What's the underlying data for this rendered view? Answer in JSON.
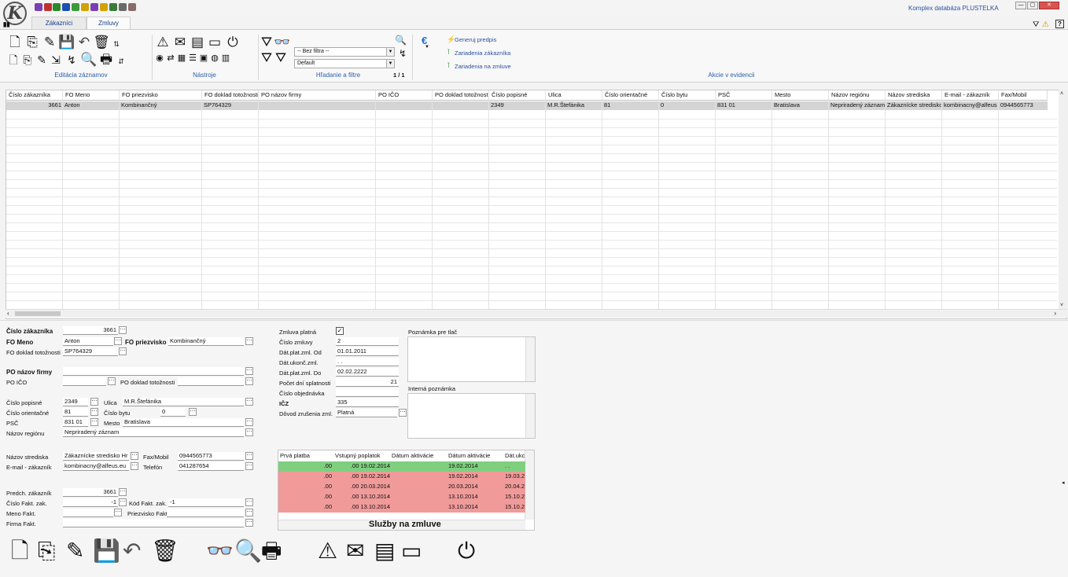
{
  "app": {
    "logo": "K",
    "right_title": "Komplex  databáza PLUSTELKA",
    "window_buttons": [
      "—",
      "▢",
      "✕"
    ]
  },
  "quick_access": [
    {
      "name": "users-icon",
      "color": "#7b3fb3"
    },
    {
      "name": "mail-icon",
      "color": "#c03030"
    },
    {
      "name": "tag-icon",
      "color": "#2a8a2a"
    },
    {
      "name": "book-icon",
      "color": "#1a4fb0"
    },
    {
      "name": "cash-icon",
      "color": "#3a9a3a"
    },
    {
      "name": "euro-icon",
      "color": "#d2a200"
    },
    {
      "name": "phone-icon",
      "color": "#7b3fb3"
    },
    {
      "name": "euro2-icon",
      "color": "#d2a200"
    },
    {
      "name": "people-icon",
      "color": "#3a7a3a"
    },
    {
      "name": "user-icon",
      "color": "#6a6a6a"
    },
    {
      "name": "satellite-icon",
      "color": "#8a6a6a"
    }
  ],
  "tabs": [
    {
      "label": "Zákazníci"
    },
    {
      "label": "Zmluvy"
    }
  ],
  "ribbon": {
    "groups": [
      "Editácia záznamov",
      "Nástroje",
      "Hľadanie a filtre",
      "Akcie v evidencii"
    ],
    "filter1": "-- Bez filtra --",
    "filter2": "Default",
    "pager": "1 / 1",
    "actions": [
      "Generuj predpis",
      "Zariadenia zákazníka",
      "Zariadenia na zmluve"
    ]
  },
  "grid": {
    "columns": [
      "Číslo zákazníka",
      "FO Meno",
      "FO priezvisko",
      "FO doklad totožnosti",
      "PO názov firmy",
      "PO IČO",
      "PO doklad totožnosti",
      "Číslo popisné",
      "Ulica",
      "Číslo orientačné",
      "Číslo bytu",
      "PSČ",
      "Mesto",
      "Názov regiónu",
      "Názov strediska",
      "E-mail - zákazník",
      "Fax/Mobil"
    ],
    "rows": [
      [
        "3661",
        "Anton",
        "Kombinančný",
        "SP764329",
        "",
        "",
        "",
        "2349",
        "M.R.Štefánika",
        "81",
        "0",
        "831 01",
        "Bratislava",
        "Nepriradený záznam",
        "Zákaznícke stredisko",
        "kombinacny@alfeus",
        "0944565773"
      ]
    ]
  },
  "form": {
    "cislo_zakaznika_label": "Číslo zákazníka",
    "cislo_zakaznika": "3661",
    "fo_meno_label": "FO Meno",
    "fo_meno": "Anton",
    "fo_priezvisko_label": "FO priezvisko",
    "fo_priezvisko": "Kombinančný",
    "fo_doklad_label": "FO doklad totožnosti",
    "fo_doklad": "SP764329",
    "po_nazov_label": "PO názov firmy",
    "po_nazov": "",
    "po_ico_label": "PO IČO",
    "po_ico": "",
    "po_doklad_label": "PO doklad totožnosti",
    "po_doklad": "",
    "cislo_popisne_label": "Číslo popisné",
    "cislo_popisne": "2349",
    "ulica_label": "Ulica",
    "ulica": "M.R.Štefánika",
    "cislo_orientacne_label": "Číslo orientačné",
    "cislo_orientacne": "81",
    "cislo_bytu_label": "Číslo bytu",
    "cislo_bytu": "0",
    "psc_label": "PSČ",
    "psc": "831 01",
    "mesto_label": "Mesto",
    "mesto": "Bratislava",
    "region_label": "Názov regiónu",
    "region": "Nepriradený záznam",
    "stredisko_label": "Názov strediska",
    "stredisko": "Zákaznícke stredisko Hr",
    "fax_label": "Fax/Mobil",
    "fax": "0944565773",
    "email_label": "E-mail - zákazník",
    "email": "kombinacny@alfeus.eu",
    "telefon_label": "Telefón",
    "telefon": "041287654",
    "predch_label": "Predch. zákazník",
    "predch": "3661",
    "fakt_zak_label": "Číslo Fakt. zak.",
    "fakt_zak": "-1",
    "kod_fakt_label": "Kód Fakt. zak.",
    "kod_fakt": "-1",
    "meno_fakt_label": "Meno Fakt.",
    "meno_fakt": "",
    "priezvisko_fakt_label": "Priezvisko Fakt.",
    "priezvisko_fakt": "",
    "firma_fakt_label": "Firma Fakt.",
    "firma_fakt": ""
  },
  "contract": {
    "platna_label": "Zmluva platná",
    "platna_check": "✓",
    "cislo_label": "Číslo zmluvy",
    "cislo": "2",
    "od_label": "Dát.plat.zml. Od",
    "od": "01.01.2011",
    "ukonc_label": "Dát.ukonč.zml.",
    "ukonc": ". .",
    "do_label": "Dát.plat.zml. Do",
    "do": "02.02.2222",
    "splatnost_label": "Počet dní splatnosti",
    "splatnost": "21",
    "objednavka_label": "Číslo objednávka",
    "objednavka": "",
    "icz_label": "IČZ",
    "icz": "335",
    "dovod_label": "Dôvod zrušenia zml.",
    "dovod": "Platná",
    "poznamka_tlac_label": "Poznámka pre tlač",
    "interna_label": "Interná poznámka"
  },
  "services": {
    "columns": [
      "Prvá platba",
      "Vstupný poplatok",
      "Dátum aktivácie",
      "Dátum aktivácie",
      "Dát.ukc"
    ],
    "rows": [
      {
        "c": [
          ".00",
          ".00 19.02.2014",
          "19.02.2014",
          ". ."
        ],
        "color": "#7fcf7f"
      },
      {
        "c": [
          ".00",
          ".00 19.02.2014",
          "19.02.2014",
          "19.03.2"
        ],
        "color": "#f19a9a"
      },
      {
        "c": [
          ".00",
          ".00 20.03.2014",
          "20.03.2014",
          "20.04.2"
        ],
        "color": "#f19a9a"
      },
      {
        "c": [
          ".00",
          ".00 13.10.2014",
          "13.10.2014",
          "15.10.2"
        ],
        "color": "#f19a9a"
      },
      {
        "c": [
          ".00",
          ".00 13.10.2014",
          "13.10.2014",
          "15.10.2"
        ],
        "color": "#f19a9a"
      }
    ],
    "title": "Služby na zmluve"
  }
}
